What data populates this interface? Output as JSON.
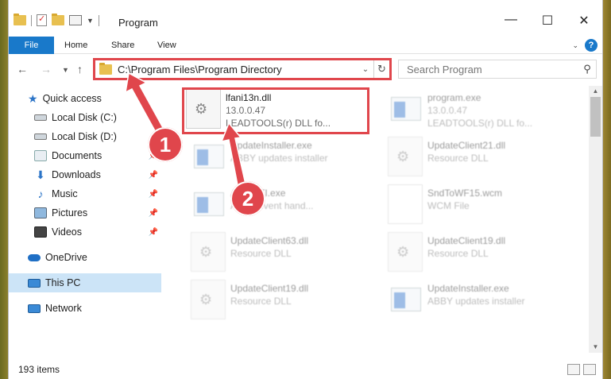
{
  "window": {
    "title": "Program",
    "controls": {
      "minimize": "—",
      "maximize": "☐",
      "close": "✕"
    }
  },
  "ribbon": {
    "file": "File",
    "tabs": [
      "Home",
      "Share",
      "View"
    ],
    "help": "?"
  },
  "address": {
    "path": "C:\\Program Files\\Program Directory"
  },
  "search": {
    "placeholder": "Search Program"
  },
  "sidebar": {
    "quick_access": "Quick access",
    "items": [
      {
        "label": "Local Disk (C:)",
        "icon": "drive-icon"
      },
      {
        "label": "Local Disk (D:)",
        "icon": "drive-icon"
      },
      {
        "label": "Documents",
        "icon": "documents-icon"
      },
      {
        "label": "Downloads",
        "icon": "downloads-icon"
      },
      {
        "label": "Music",
        "icon": "music-icon"
      },
      {
        "label": "Pictures",
        "icon": "pictures-icon"
      },
      {
        "label": "Videos",
        "icon": "videos-icon"
      }
    ],
    "onedrive": "OneDrive",
    "this_pc": "This PC",
    "network": "Network"
  },
  "files": [
    {
      "name": "lfani13n.dll",
      "line2": "13.0.0.47",
      "line3": "LEADTOOLS(r) DLL fo...",
      "type": "dll",
      "highlighted": true
    },
    {
      "name": "program.exe",
      "line2": "13.0.0.47",
      "line3": "LEADTOOLS(r) DLL fo...",
      "type": "exe"
    },
    {
      "name": "UpdateInstaller.exe",
      "line2": "ABBY updates installer",
      "type": "exe"
    },
    {
      "name": "UpdateClient21.dll",
      "line2": "Resource DLL",
      "type": "dll"
    },
    {
      "name": "AbbyUTI.exe",
      "line2": "ABBY event hand...",
      "type": "exe"
    },
    {
      "name": "SndToWF15.wcm",
      "line2": "WCM File",
      "type": "wcm"
    },
    {
      "name": "UpdateClient63.dll",
      "line2": "Resource DLL",
      "type": "dll"
    },
    {
      "name": "UpdateClient19.dll",
      "line2": "Resource DLL",
      "type": "dll"
    },
    {
      "name": "UpdateClient19.dll",
      "line2": "Resource DLL",
      "type": "dll"
    },
    {
      "name": "UpdateInstaller.exe",
      "line2": "ABBY updates installer",
      "type": "exe"
    }
  ],
  "status": {
    "count": "193 items"
  },
  "annotations": {
    "step1": "1",
    "step2": "2",
    "color": "#e0464c"
  }
}
